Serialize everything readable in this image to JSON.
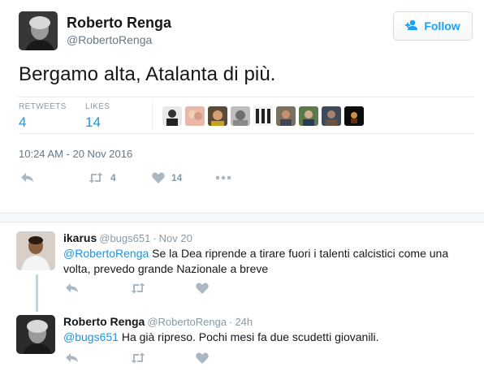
{
  "tweet": {
    "author_name": "Roberto Renga",
    "author_handle": "@RobertoRenga",
    "follow_label": "Follow",
    "text": "Bergamo alta, Atalanta di più.",
    "stats": {
      "retweets_label": "RETWEETS",
      "retweets_value": "4",
      "likes_label": "LIKES",
      "likes_value": "14"
    },
    "timestamp": "10:24 AM - 20 Nov 2016",
    "actions": {
      "retweet_count": "4",
      "like_count": "14"
    }
  },
  "replies": [
    {
      "name": "ikarus",
      "handle": "@bugs651",
      "time": "Nov 20",
      "mention": "@RobertoRenga",
      "text": " Se la Dea riprende a tirare fuori i talenti calcistici come una volta, prevedo grande Nazionale a breve"
    },
    {
      "name": "Roberto Renga",
      "handle": "@RobertoRenga",
      "time": "24h",
      "mention": "@bugs651",
      "text": " Ha già ripreso. Pochi mesi fa due scudetti giovanili."
    }
  ],
  "colors": {
    "accent": "#1b95e0",
    "muted": "#8899a6",
    "text": "#14171a"
  },
  "icons": {
    "follow": "add-user-icon",
    "reply": "reply-icon",
    "retweet": "retweet-icon",
    "like": "heart-icon",
    "more": "more-dots-icon"
  }
}
